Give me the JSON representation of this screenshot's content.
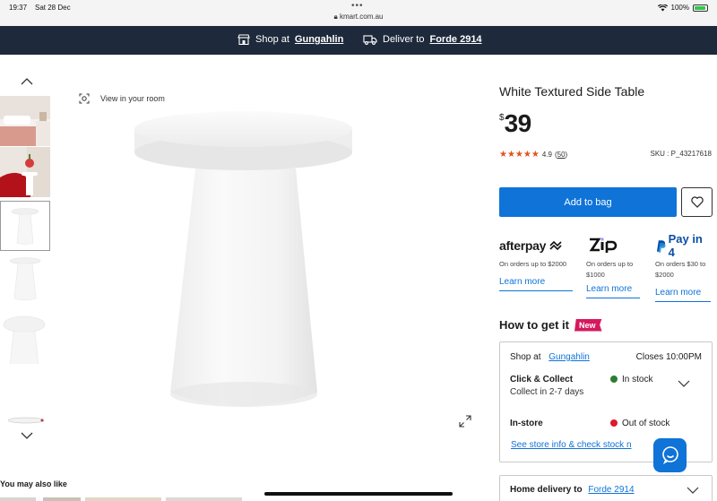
{
  "status_bar": {
    "time": "19:37",
    "date": "Sat 28 Dec",
    "url": "kmart.com.au",
    "battery": "100%"
  },
  "top_bar": {
    "shop_prefix": "Shop at",
    "shop_store": "Gungahlin",
    "deliver_prefix": "Deliver to",
    "deliver_location": "Forde 2914",
    "bg_color": "#1e2a3b"
  },
  "gallery": {
    "view_in_room": "View in your room",
    "thumbnails": [
      "bedroom-scene",
      "christmas-scene",
      "side-table-front",
      "side-table-plain",
      "side-table-tall",
      "side-table-top"
    ]
  },
  "product": {
    "title": "White Textured Side Table",
    "currency": "$",
    "price": "39",
    "rating": "4.9",
    "review_count": "50",
    "rating_stars": 5,
    "sku": "SKU : P_43217618",
    "add_to_bag": "Add to bag",
    "accent_color": "#0f73d8"
  },
  "payments": [
    {
      "name": "afterpay",
      "desc": "On orders up to $2000",
      "learn": "Learn more"
    },
    {
      "name": "zip",
      "desc": "On orders up to $1000",
      "learn": "Learn more"
    },
    {
      "name": "Pay in 4",
      "desc": "On orders $30 to $2000",
      "learn": "Learn more"
    }
  ],
  "how_to_get": {
    "heading": "How to get it",
    "badge": "New",
    "shop_at": "Shop at",
    "store": "Gungahlin",
    "closes": "Closes 10:00PM",
    "click_collect_title": "Click & Collect",
    "click_collect_sub": "Collect in 2-7 days",
    "click_collect_status": "In stock",
    "in_store_title": "In-store",
    "in_store_status": "Out of stock",
    "store_info_link": "See store info & check stock n",
    "home_delivery_prefix": "Home delivery to",
    "home_delivery_location": "Forde 2914"
  },
  "recommendations": {
    "heading": "You may also like"
  }
}
